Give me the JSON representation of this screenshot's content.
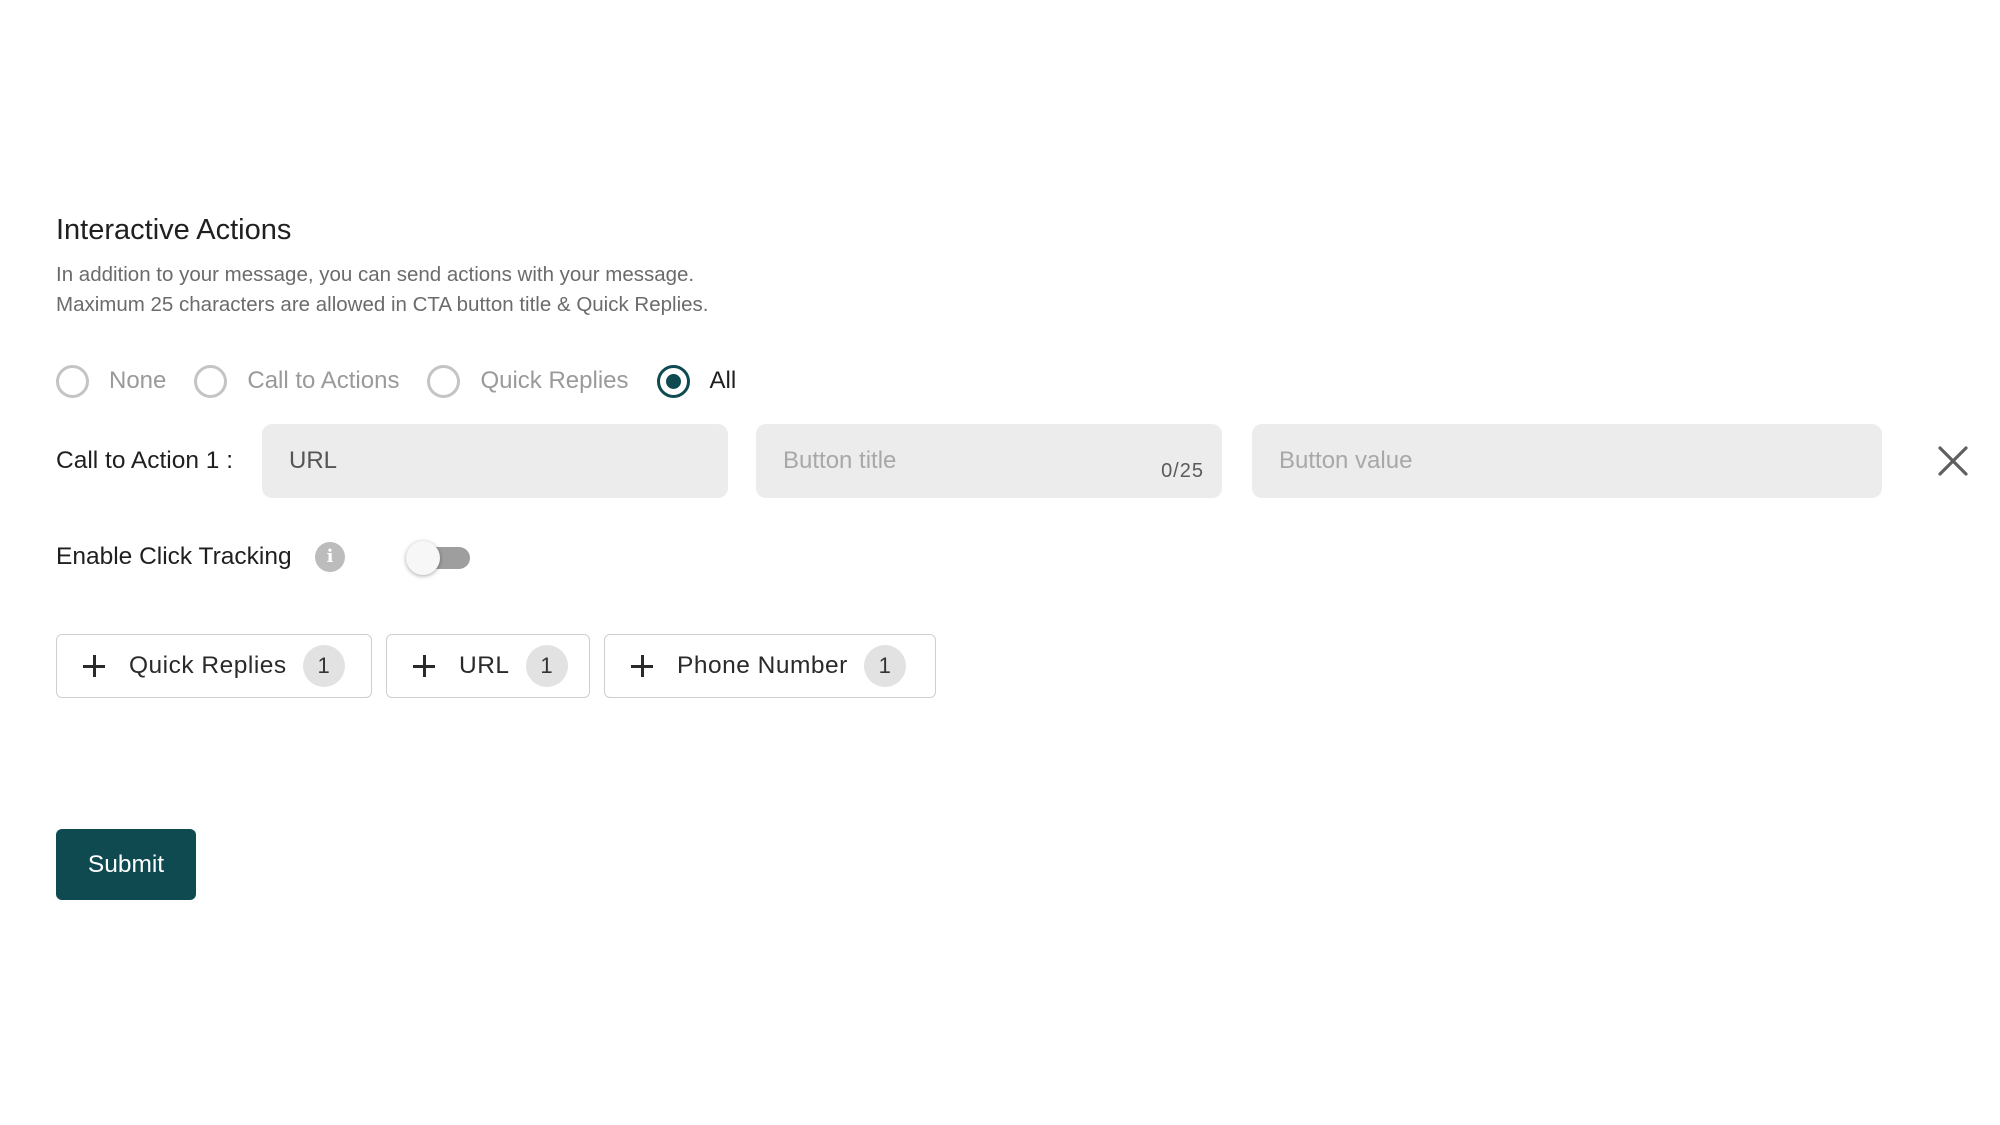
{
  "section": {
    "title": "Interactive Actions",
    "description_line1": "In addition to your message, you can send actions with your message.",
    "description_line2": "Maximum 25 characters are allowed in CTA button title & Quick Replies."
  },
  "action_type": {
    "options": [
      {
        "label": "None",
        "checked": false
      },
      {
        "label": "Call to Actions",
        "checked": false
      },
      {
        "label": "Quick Replies",
        "checked": false
      },
      {
        "label": "All",
        "checked": true
      }
    ]
  },
  "cta": {
    "label": "Call to Action 1 :",
    "type_value": "URL",
    "title_placeholder": "Button title",
    "title_counter": "0/25",
    "value_placeholder": "Button value"
  },
  "tracking": {
    "label": "Enable Click Tracking",
    "info_glyph": "i",
    "enabled": false
  },
  "add_buttons": [
    {
      "label": "Quick Replies",
      "count": "1"
    },
    {
      "label": "URL",
      "count": "1"
    },
    {
      "label": "Phone Number",
      "count": "1"
    }
  ],
  "submit_label": "Submit",
  "colors": {
    "accent": "#0e4a50",
    "field_bg": "#ececec",
    "toggle_off": "#9e9e9e"
  },
  "icons": {
    "close": "close-icon",
    "info": "info-icon",
    "plus": "plus-icon"
  }
}
